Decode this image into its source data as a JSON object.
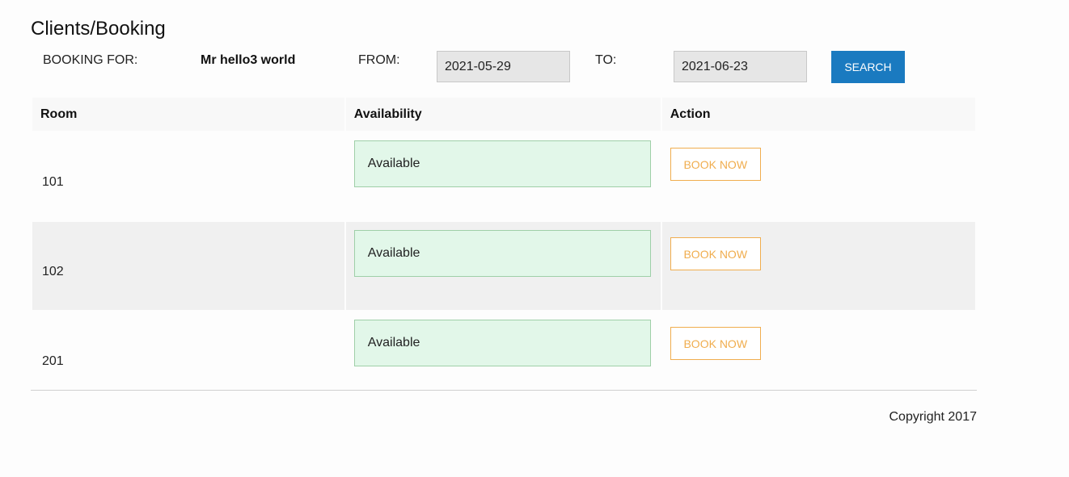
{
  "page": {
    "title": "Clients/Booking"
  },
  "filter": {
    "booking_for_label": "BOOKING FOR:",
    "client_name": "Mr hello3 world",
    "from_label": "FROM:",
    "from_value": "2021-05-29",
    "to_label": "TO:",
    "to_value": "2021-06-23",
    "search_label": "SEARCH"
  },
  "table": {
    "headers": {
      "room": "Room",
      "availability": "Availability",
      "action": "Action"
    },
    "rows": [
      {
        "room": "101",
        "availability": "Available",
        "action": "BOOK NOW"
      },
      {
        "room": "102",
        "availability": "Available",
        "action": "BOOK NOW"
      },
      {
        "room": "201",
        "availability": "Available",
        "action": "BOOK NOW"
      }
    ]
  },
  "footer": {
    "copyright": "Copyright 2017"
  },
  "colors": {
    "search_button": "#1a7ac0",
    "book_now": "#f0ad4e",
    "available_bg": "#e2f7e9",
    "available_border": "#9fcfa8"
  }
}
